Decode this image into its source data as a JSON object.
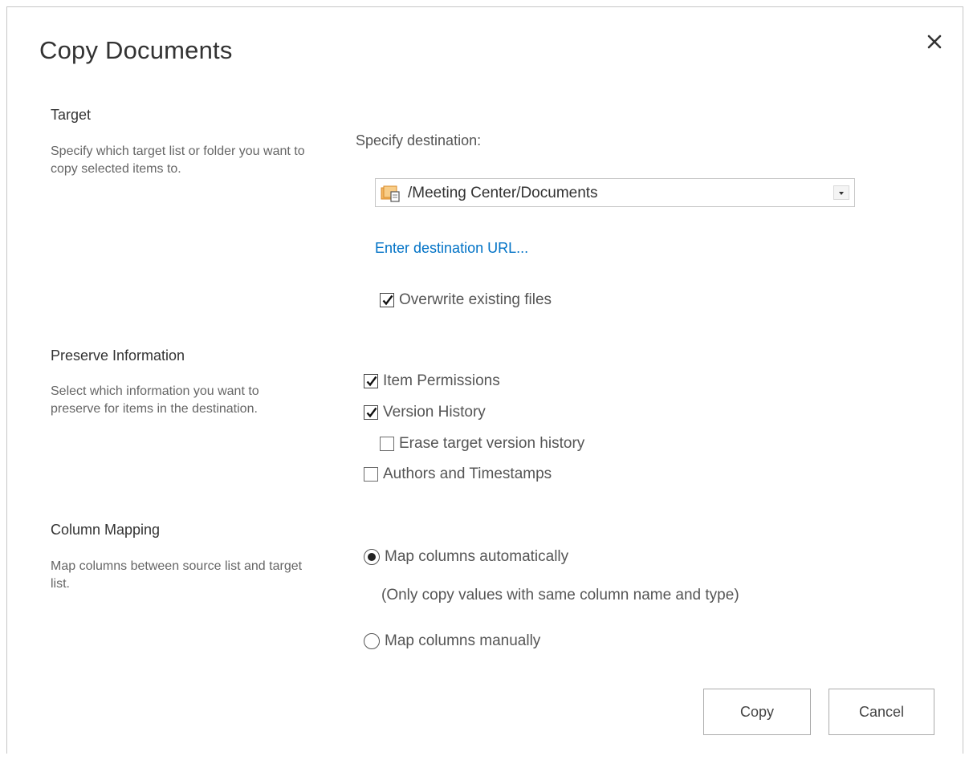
{
  "dialog": {
    "title": "Copy Documents"
  },
  "target": {
    "heading": "Target",
    "description": "Specify which target list or folder you want to copy selected items to.",
    "destination_label": "Specify destination:",
    "destination_value": "/Meeting Center/Documents",
    "destination_icon": "folder-icon",
    "enter_url_link": "Enter destination URL...",
    "overwrite": {
      "label": "Overwrite existing files",
      "checked": true
    }
  },
  "preserve": {
    "heading": "Preserve Information",
    "description": "Select which information you want to preserve for items in the destination.",
    "options": [
      {
        "label": "Item Permissions",
        "checked": true
      },
      {
        "label": "Version History",
        "checked": true
      },
      {
        "label": "Erase target version history",
        "checked": false
      },
      {
        "label": "Authors and Timestamps",
        "checked": false
      }
    ]
  },
  "mapping": {
    "heading": "Column Mapping",
    "description": "Map columns between source list and target list.",
    "auto": {
      "label": "Map columns automatically",
      "selected": true
    },
    "auto_note": "(Only copy values with same column name and type)",
    "manual": {
      "label": "Map columns manually",
      "selected": false
    }
  },
  "buttons": {
    "copy": "Copy",
    "cancel": "Cancel"
  },
  "colors": {
    "link": "#0072c6",
    "border": "#c6c6c6",
    "text": "#444444"
  }
}
